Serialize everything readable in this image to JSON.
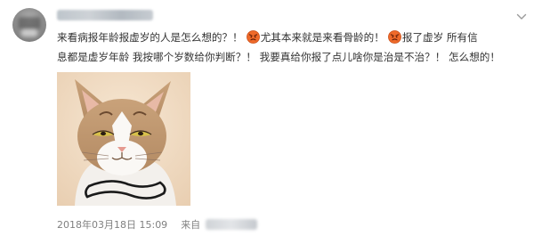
{
  "post": {
    "text_line1_part1": "来看病报年龄报虚岁的人是怎么想的？！",
    "text_line1_part2": "尤其本来就是来看骨龄的！",
    "text_line1_part3": "报了虚岁 所有信",
    "text_line2": "息都是虚岁年龄 我按哪个岁数给你判断？！ 我要真给你报了点儿啥你是治是不治？！ 怎么想的！",
    "emoji_icon": "angry-face-emoji",
    "image_icon": "cat-photo",
    "timestamp": "2018年03月18日 15:09",
    "source_prefix": "来自"
  },
  "colors": {
    "text": "#333333",
    "meta_text": "#808080",
    "emoji": "#ef6a2a"
  }
}
